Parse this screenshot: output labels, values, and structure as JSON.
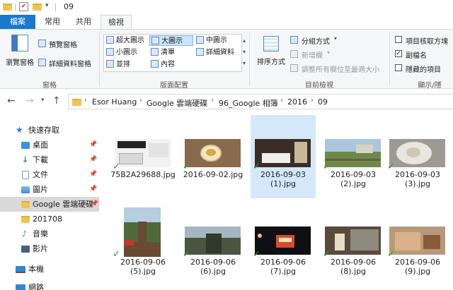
{
  "titlebar": {
    "title": "09"
  },
  "tabs": [
    {
      "label": "檔案"
    },
    {
      "label": "常用"
    },
    {
      "label": "共用"
    },
    {
      "label": "檢視"
    }
  ],
  "ribbon": {
    "panes": {
      "label": "窗格",
      "nav_pane": "瀏覽窗格",
      "preview_pane": "預覽窗格",
      "details_pane": "詳細資料窗格"
    },
    "layout": {
      "label": "版面配置",
      "items": [
        "超大圖示",
        "大圖示",
        "中圖示",
        "小圖示",
        "清單",
        "詳細資料",
        "並排",
        "內容"
      ],
      "selected": "大圖示"
    },
    "current_view": {
      "label": "目前檢視",
      "sort_by": "排序方式",
      "group_by": "分組方式",
      "add_columns": "新增欄",
      "size_all": "調整所有欄位至最適大小"
    },
    "show_hide": {
      "label": "顯示/隱",
      "item_checkboxes": "項目核取方塊",
      "item_checkboxes_checked": false,
      "file_ext": "副檔名",
      "file_ext_checked": true,
      "hidden_items": "隱藏的項目",
      "hidden_items_checked": false
    }
  },
  "address": {
    "crumbs": [
      "Esor Huang",
      "Google 雲端硬碟",
      "96_Google 相簿",
      "2016",
      "09"
    ]
  },
  "nav": {
    "quick_access": "快速存取",
    "items": [
      {
        "label": "桌面",
        "pinned": true
      },
      {
        "label": "下載",
        "pinned": true
      },
      {
        "label": "文件",
        "pinned": true
      },
      {
        "label": "圖片",
        "pinned": true
      },
      {
        "label": "Google 雲端硬碟",
        "pinned": true,
        "selected": true
      },
      {
        "label": "201708",
        "pinned": false
      },
      {
        "label": "音樂",
        "pinned": false
      },
      {
        "label": "影片",
        "pinned": false
      }
    ],
    "this_pc": "本機",
    "network": "網路"
  },
  "files": [
    {
      "line1": "75B2A29688.jpg",
      "line2": "",
      "selected": false
    },
    {
      "line1": "2016-09-02.jpg",
      "line2": "",
      "selected": false
    },
    {
      "line1": "2016-09-03",
      "line2": "(1).jpg",
      "selected": true
    },
    {
      "line1": "2016-09-03",
      "line2": "(2).jpg",
      "selected": false
    },
    {
      "line1": "2016-09-03",
      "line2": "(3).jpg",
      "selected": false
    },
    {
      "line1": "2016-09-06",
      "line2": "(5).jpg",
      "selected": false
    },
    {
      "line1": "2016-09-06",
      "line2": "(6).jpg",
      "selected": false
    },
    {
      "line1": "2016-09-06",
      "line2": "(7).jpg",
      "selected": false
    },
    {
      "line1": "2016-09-06",
      "line2": "(8).jpg",
      "selected": false
    },
    {
      "line1": "2016-09-06",
      "line2": "(9).jpg",
      "selected": false
    }
  ],
  "colors": {
    "accent": "#1979ca",
    "selection": "#d5e8fa",
    "sync_ok": "#2aa52a"
  }
}
